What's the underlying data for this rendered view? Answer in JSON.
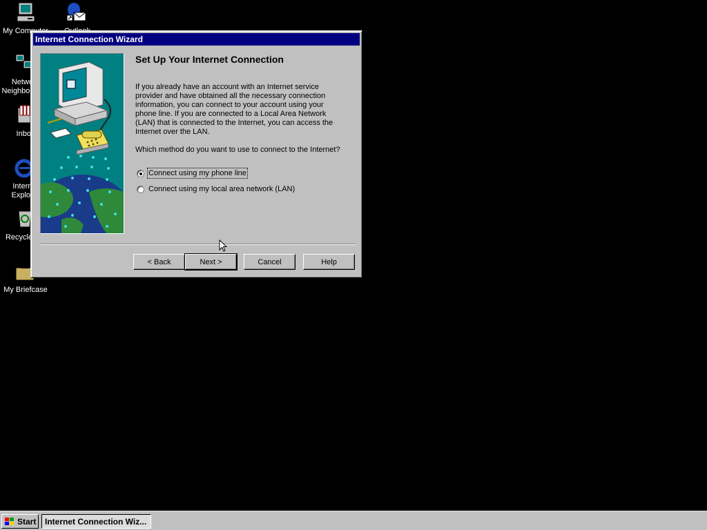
{
  "desktop": {
    "icons": [
      {
        "label": "My Computer"
      },
      {
        "label": "Outlook"
      },
      {
        "label": "Network Neighborhood"
      },
      {
        "label": "Inbox"
      },
      {
        "label": "Internet Explorer"
      },
      {
        "label": "Recycle Bin"
      },
      {
        "label": "My Briefcase"
      }
    ]
  },
  "window": {
    "title": "Internet Connection Wizard",
    "heading": "Set Up Your Internet Connection",
    "paragraph": "If you already have an account with an Internet service provider and have obtained all the necessary connection information, you can connect to your account using your phone line. If you are connected to a Local Area Network (LAN) that is connected to the Internet, you can access the Internet over the LAN.",
    "question": "Which method do you want to use to connect to the Internet?",
    "options": [
      {
        "label": "Connect using my phone line",
        "checked": true
      },
      {
        "label": "Connect using my local area network (LAN)",
        "checked": false
      }
    ],
    "buttons": {
      "back": "< Back",
      "next": "Next >",
      "cancel": "Cancel",
      "help": "Help"
    }
  },
  "taskbar": {
    "start_label": "Start",
    "task_label": "Internet Connection Wiz..."
  },
  "colors": {
    "desktop": "#000000",
    "titlebar": "#000080",
    "face": "#c0c0c0"
  }
}
